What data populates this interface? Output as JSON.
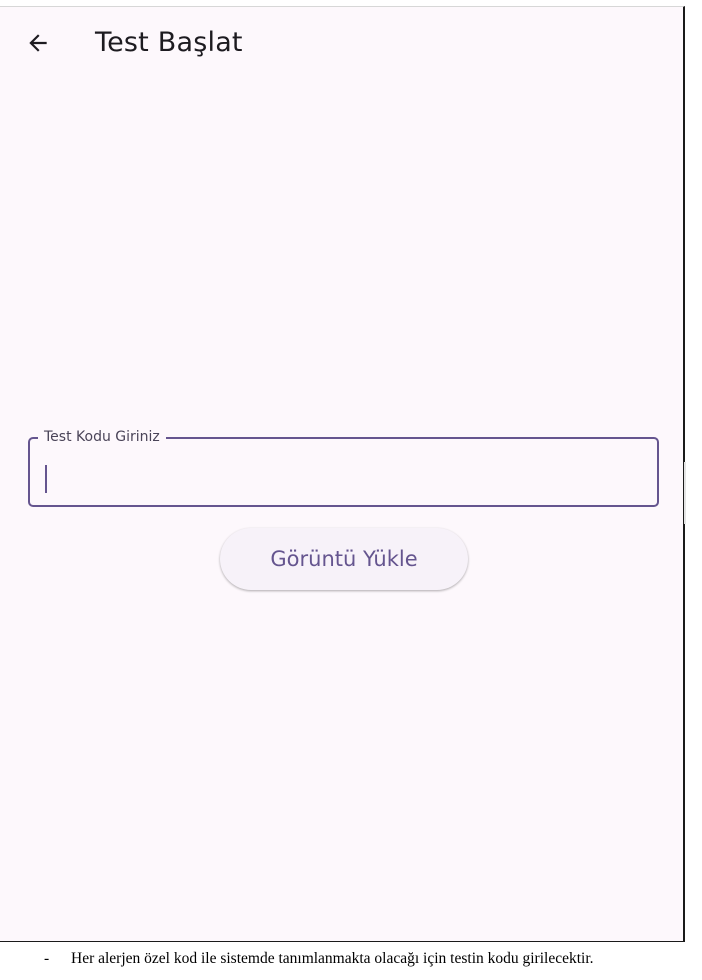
{
  "app_bar": {
    "back_icon": "arrow-left-icon",
    "title": "Test Başlat"
  },
  "test_code_field": {
    "label": "Test Kodu Giriniz",
    "value": "",
    "accent_color": "#65558f"
  },
  "upload_button": {
    "label": "Görüntü Yükle"
  },
  "caption": {
    "bullet": "-",
    "text": "Her alerjen özel kod ile sistemde tanımlanmakta olacağı için testin kodu girilecektir."
  },
  "colors": {
    "screen_background": "#fdf8fc",
    "primary": "#65558f",
    "text": "#1d1b20"
  }
}
